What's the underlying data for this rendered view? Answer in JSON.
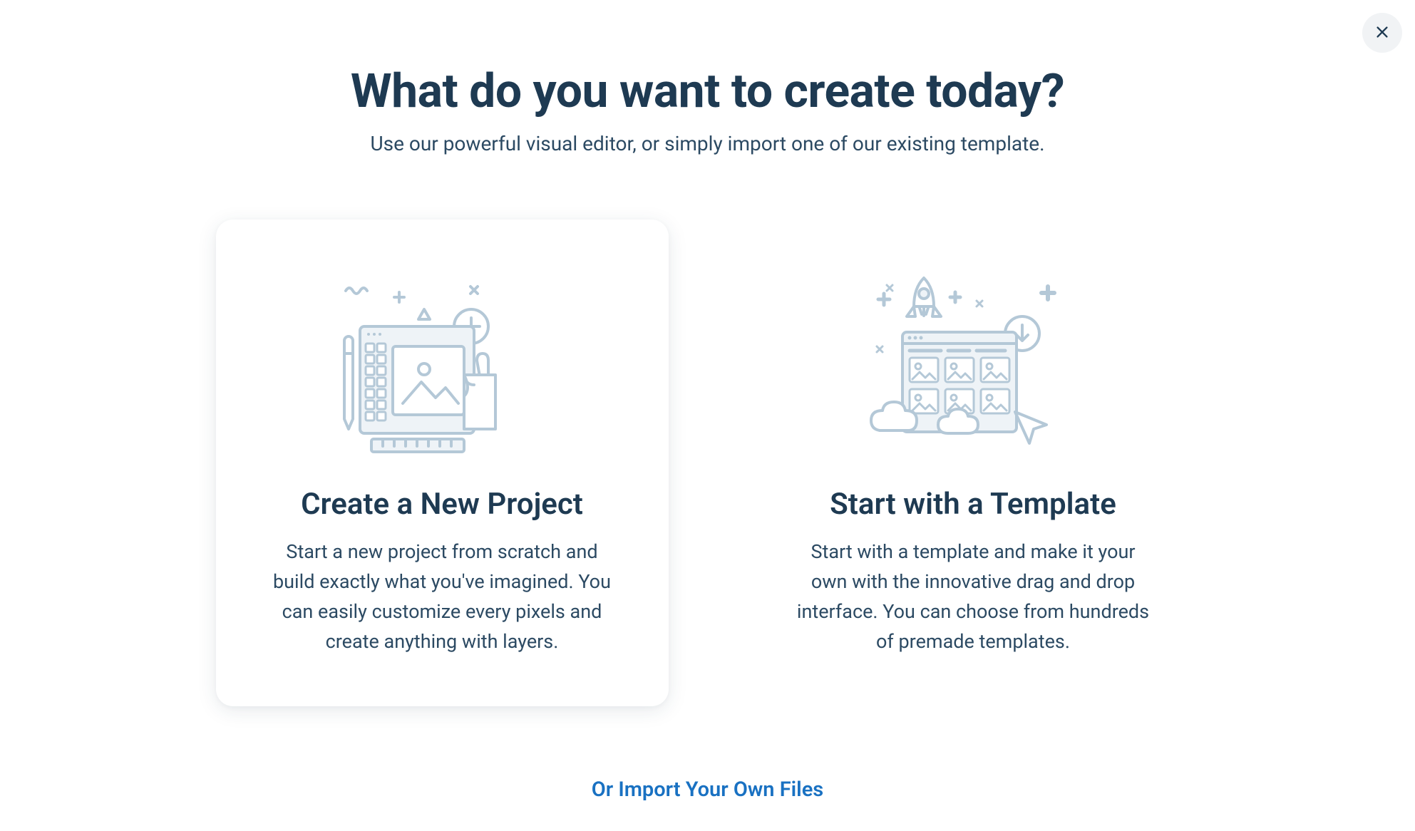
{
  "header": {
    "title": "What do you want to create today?",
    "subtitle": "Use our powerful visual editor, or simply import one of our existing template."
  },
  "options": {
    "new_project": {
      "title": "Create a New Project",
      "description": "Start a new project from scratch and build exactly what you've imagined. You can easily customize every pixels and create anything with layers."
    },
    "template": {
      "title": "Start with a Template",
      "description": "Start with a template and make it your own with the innovative drag and drop interface. You can choose from hundreds of premade templates."
    }
  },
  "footer": {
    "import_link": "Or Import Your Own Files"
  },
  "colors": {
    "illustration_stroke": "#b4c8d7",
    "illustration_fill": "#eef3f7",
    "text_primary": "#1e3a52",
    "text_secondary": "#2c4a63",
    "link": "#1971c2"
  }
}
